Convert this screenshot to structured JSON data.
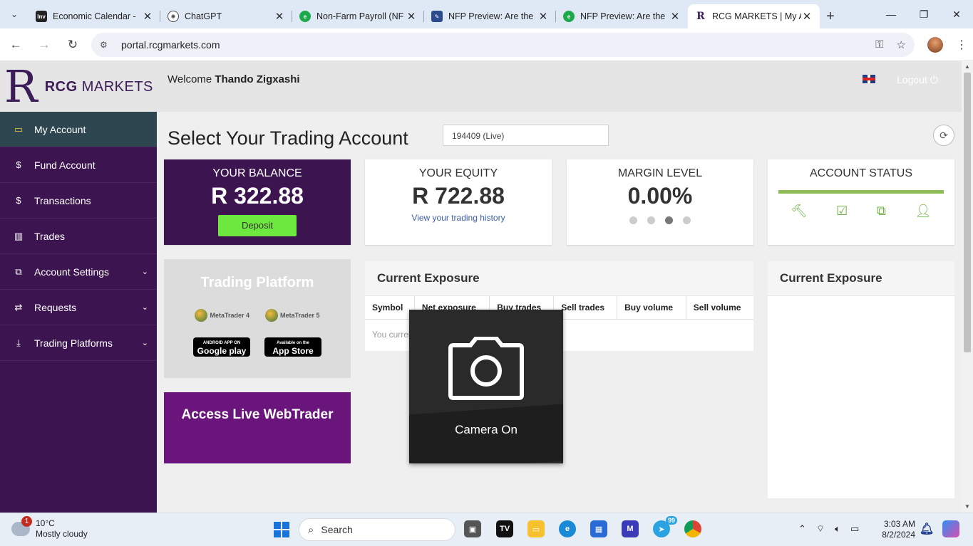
{
  "browser": {
    "tabs": [
      {
        "title": "Economic Calendar -",
        "favicon": "Inv",
        "color": "#222222"
      },
      {
        "title": "ChatGPT",
        "favicon": "chatgpt-icon",
        "color": "#444444"
      },
      {
        "title": "Non-Farm Payroll (NF",
        "favicon": "green-e-icon",
        "color": "#1ba94c"
      },
      {
        "title": "NFP Preview: Are the",
        "favicon": "fxstreet-icon",
        "color": "#2b4c8c"
      },
      {
        "title": "NFP Preview: Are the",
        "favicon": "green-e-icon",
        "color": "#1ba94c"
      },
      {
        "title": "RCG MARKETS | My A",
        "favicon": "R",
        "color": "#3d1d57"
      }
    ],
    "url": "portal.rcgmarkets.com"
  },
  "header": {
    "logo_letter": "R",
    "logo_bold": "RCG",
    "logo_rest": " MARKETS",
    "welcome_prefix": "Welcome",
    "user_name": "Thando Zigxashi",
    "logout_label": "Logout"
  },
  "sidebar": {
    "items": [
      {
        "label": "My Account",
        "icon": "monitor-icon"
      },
      {
        "label": "Fund Account",
        "icon": "dollar-icon"
      },
      {
        "label": "Transactions",
        "icon": "dollar-icon"
      },
      {
        "label": "Trades",
        "icon": "bar-chart-icon"
      },
      {
        "label": "Account Settings",
        "icon": "copy-icon"
      },
      {
        "label": "Requests",
        "icon": "exchange-icon"
      },
      {
        "label": "Trading Platforms",
        "icon": "download-icon"
      }
    ]
  },
  "main": {
    "title": "Select Your Trading Account",
    "account_selected": "194409 (Live)",
    "balance": {
      "label": "YOUR BALANCE",
      "value": "R 322.88",
      "button": "Deposit"
    },
    "equity": {
      "label": "YOUR EQUITY",
      "value": "R 722.88",
      "link": "View your trading history"
    },
    "margin": {
      "label": "MARGIN LEVEL",
      "value": "0.00%",
      "active_dot": 3
    },
    "account_status": {
      "label": "ACCOUNT STATUS",
      "progress": 1.0
    },
    "platform": {
      "title": "Trading Platform",
      "mt4": "MetaTrader 4",
      "mt5": "MetaTrader 5",
      "google_play": "Google play",
      "google_play_top": "ANDROID APP ON",
      "app_store": "App Store",
      "app_store_top": "Available on the"
    },
    "webtrader": "Access Live WebTrader",
    "exposure": {
      "title": "Current Exposure",
      "columns": [
        "Symbol",
        "Net exposure",
        "Buy trades",
        "Sell trades",
        "Buy volume",
        "Sell volume"
      ],
      "empty_message": "You currently do not have any open trades"
    },
    "exposure2": {
      "title": "Current Exposure"
    }
  },
  "camera_overlay": {
    "label": "Camera On"
  },
  "taskbar": {
    "weather_temp": "10°C",
    "weather_desc": "Mostly cloudy",
    "weather_badge": "1",
    "search_label": "Search",
    "telegram_badge": "99",
    "time": "3:03 AM",
    "date": "8/2/2024"
  }
}
